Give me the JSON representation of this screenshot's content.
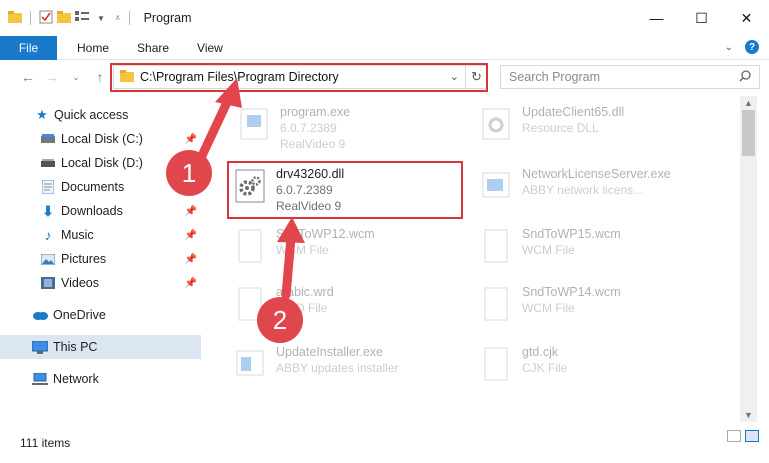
{
  "window": {
    "title": "Program",
    "minimize": "—",
    "maximize": "☐",
    "close": "✕"
  },
  "ribbon": {
    "tabs": [
      "File",
      "Home",
      "Share",
      "View"
    ]
  },
  "address": {
    "path": "C:\\Program Files\\Program Directory"
  },
  "search": {
    "placeholder": "Search Program"
  },
  "sidebar": {
    "items": [
      {
        "label": "Quick access"
      },
      {
        "label": "Local Disk (C:)"
      },
      {
        "label": "Local Disk (D:)"
      },
      {
        "label": "Documents"
      },
      {
        "label": "Downloads"
      },
      {
        "label": "Music"
      },
      {
        "label": "Pictures"
      },
      {
        "label": "Videos"
      },
      {
        "label": "OneDrive"
      },
      {
        "label": "This PC"
      },
      {
        "label": "Network"
      }
    ]
  },
  "files": [
    {
      "name": "program.exe",
      "line2": "6.0.7.2389",
      "line3": "RealVideo 9"
    },
    {
      "name": "UpdateClient65.dll",
      "line2": "Resource DLL",
      "line3": ""
    },
    {
      "name": "drv43260.dll",
      "line2": "6.0.7.2389",
      "line3": "RealVideo 9"
    },
    {
      "name": "NetworkLicenseServer.exe",
      "line2": "ABBY network licens...",
      "line3": ""
    },
    {
      "name": "SndToWP12.wcm",
      "line2": "WCM File",
      "line3": ""
    },
    {
      "name": "SndToWP15.wcm",
      "line2": "WCM File",
      "line3": ""
    },
    {
      "name": "arabic.wrd",
      "line2": "WRD File",
      "line3": ""
    },
    {
      "name": "SndToWP14.wcm",
      "line2": "WCM File",
      "line3": ""
    },
    {
      "name": "UpdateInstaller.exe",
      "line2": "ABBY updates installer",
      "line3": ""
    },
    {
      "name": "gtd.cjk",
      "line2": "CJK File",
      "line3": ""
    }
  ],
  "annotations": {
    "step1": "1",
    "step2": "2"
  },
  "status": {
    "count": "111 items"
  },
  "colors": {
    "accent": "#1979ca",
    "highlight": "#d9343a",
    "selected": "#dce6f2"
  }
}
